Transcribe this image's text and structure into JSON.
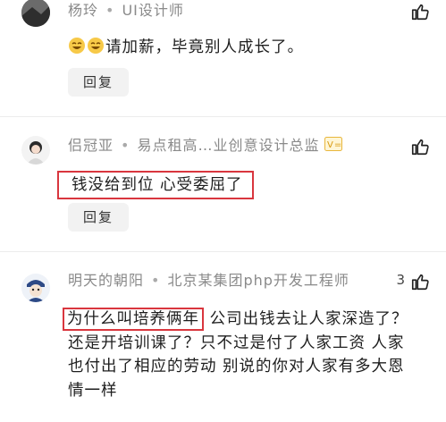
{
  "comments": [
    {
      "username": "杨玲",
      "title": "UI设计师",
      "emoji_prefix": [
        "😂",
        "😂"
      ],
      "content": "请加薪，毕竟别人成长了。",
      "reply_label": "回复",
      "like_icon": "thumb-up-icon"
    },
    {
      "username": "侣冠亚",
      "title": "易点租高…业创意设计总监",
      "badge": "V=",
      "content": "钱没给到位 心受委屈了",
      "reply_label": "回复",
      "like_icon": "thumb-up-icon"
    },
    {
      "username": "明天的朝阳",
      "title": "北京某集团php开发工程师",
      "like_count": "3",
      "content_highlight": "为什么叫培养俩年",
      "content_rest": " 公司出钱去让人家深造了？还是开培训课了？只不过是付了人家工资 人家也付出了相应的劳动 别说的你对人家有多大恩情一样",
      "like_icon": "thumb-up-icon"
    }
  ],
  "colors": {
    "highlight_border": "#d9363e",
    "meta_text": "#8a8a8a",
    "reply_bg": "#f2f2f2"
  }
}
